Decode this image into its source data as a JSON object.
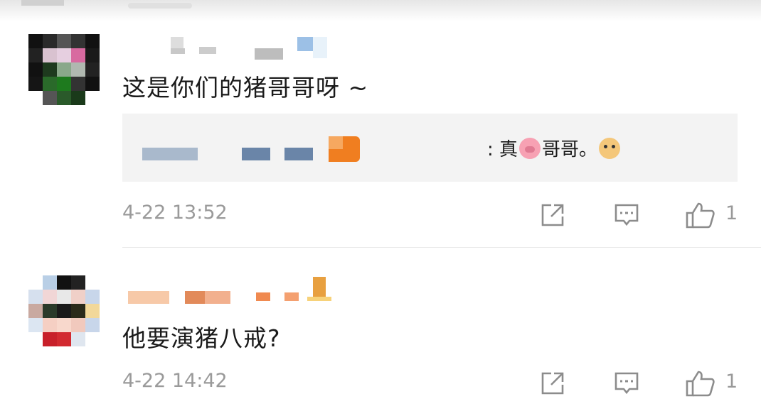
{
  "comments": [
    {
      "text": "这是你们的猪哥哥呀 ~",
      "timestamp": "4-22 13:52",
      "likes": "1",
      "reply": {
        "prefix": ": 真",
        "after_pig": "哥哥。",
        "emojis": [
          "pig-face",
          "doge-face"
        ]
      }
    },
    {
      "text": "他要演猪八戒?",
      "timestamp": "4-22 14:42",
      "likes": "1"
    }
  ],
  "icons": {
    "share": "share-icon",
    "reply": "comment-icon",
    "like": "thumbs-up-icon"
  },
  "colors": {
    "text": "#1a1a1a",
    "meta": "#9a9a9a",
    "reply_bg": "#f3f3f3"
  }
}
